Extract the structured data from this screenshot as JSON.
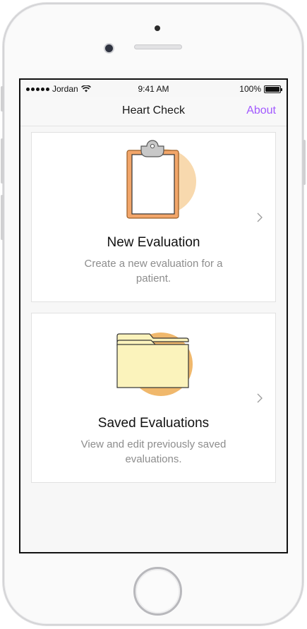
{
  "status_bar": {
    "carrier": "Jordan",
    "time": "9:41 AM",
    "battery": "100%",
    "battery_level": 1.0,
    "signal_icon": "signal-dots-icon",
    "wifi_icon": "wifi-icon",
    "battery_icon": "battery-icon"
  },
  "nav": {
    "title": "Heart Check",
    "right_action": "About",
    "accent_color": "#a259ff"
  },
  "cards": [
    {
      "title": "New Evaluation",
      "description": "Create a new evaluation for a patient.",
      "icon": "clipboard-icon",
      "chevron": "chevron-right-icon"
    },
    {
      "title": "Saved Evaluations",
      "description": "View and edit previously saved evaluations.",
      "icon": "folder-icon",
      "chevron": "chevron-right-icon"
    }
  ],
  "colors": {
    "illustration_circle": "#f8d9ae",
    "illustration_circle_dark": "#f0b86c",
    "clipboard_board": "#f2a66a",
    "folder_fill": "#fbf3bc"
  }
}
